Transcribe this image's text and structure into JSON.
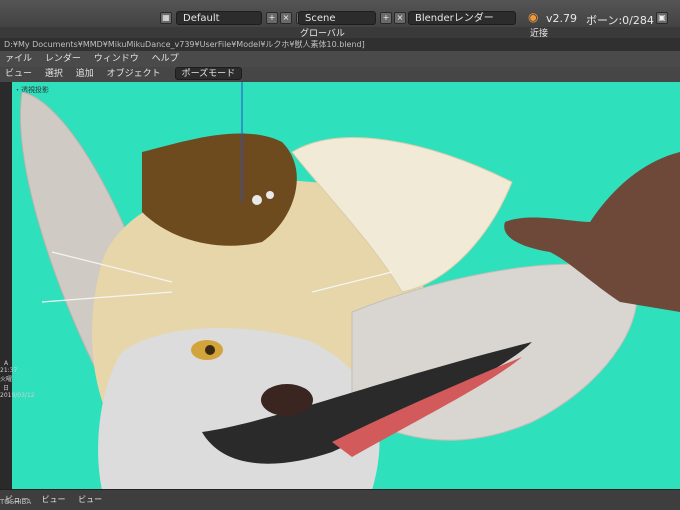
{
  "title_path": "D:¥My Documents¥MMD¥MikuMikuDance_v739¥UserFile¥Model¥ルクホ¥獣人素体10.blend]",
  "top_bar": {
    "editor_type": "Default",
    "scene": "Scene",
    "renderer": "Blenderレンダー",
    "version": "v2.79",
    "bone_count": "ボーン:0/284",
    "ui_label_1": "グローバル",
    "ui_label_2": "近接"
  },
  "main_menu": [
    "ァイル",
    "レンダー",
    "ウィンドウ",
    "ヘルプ"
  ],
  "header": {
    "items": [
      "ビュー",
      "選択",
      "追加",
      "オブジェクト"
    ],
    "mode": "ポーズモード"
  },
  "viewport": {
    "label": "・透視投影",
    "background": "#2fe0bd"
  },
  "taskbar": {
    "letter": "A",
    "time": "21:37",
    "date": "2019/03/12",
    "day": "火曜日"
  },
  "bottom_bar": {
    "items": [
      "ビュー",
      "ビュー",
      "ビュー"
    ]
  },
  "monitor_brand": "TOSHIBA"
}
